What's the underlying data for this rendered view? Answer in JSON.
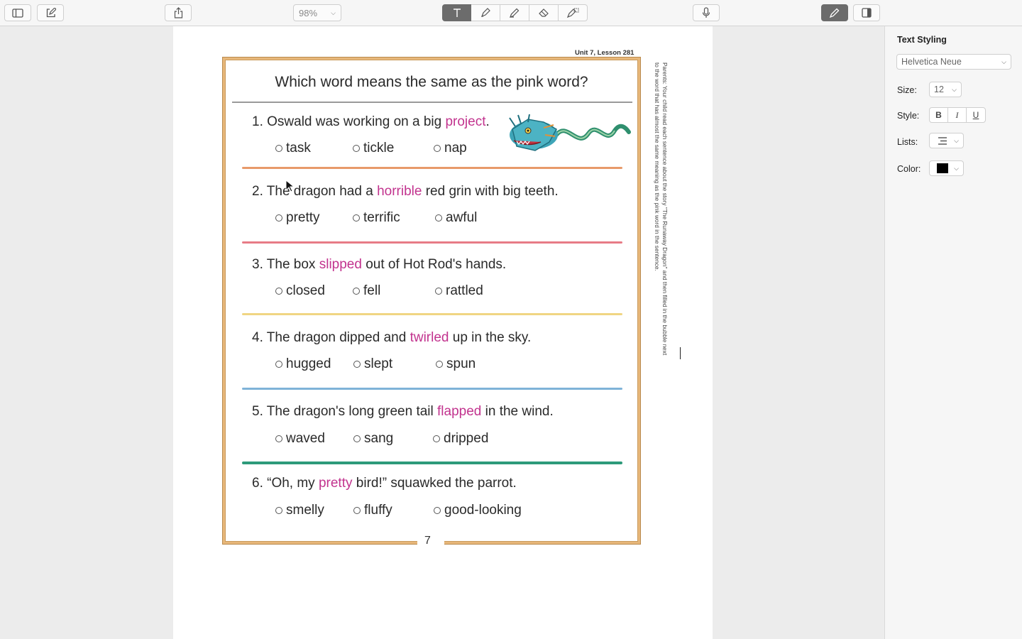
{
  "toolbar": {
    "zoom_value": "98%",
    "icons": [
      "sidebar-toggle-icon",
      "compose-icon",
      "share-icon",
      "text-tool-icon",
      "highlighter-icon",
      "pen-icon",
      "eraser-icon",
      "lasso-icon",
      "microphone-icon",
      "markup-icon",
      "inspector-icon"
    ]
  },
  "document": {
    "unit_label": "Unit 7, Lesson 281",
    "title": "Which word means the same as the pink word?",
    "side_note": "Parents: Your child read each sentence about the story \"The Runaway Dragon\" and then filled in the bubble next to the word that has almost the same meaning as the pink word in the sentence.",
    "page_number": "7",
    "questions": [
      {
        "before": "1. Oswald was working on a big ",
        "pink": "project",
        "after": ".",
        "options": [
          "task",
          "tickle",
          "nap"
        ],
        "rule_color": "#e89a6a"
      },
      {
        "before": "2. The dragon had a ",
        "pink": "horrible",
        "after": " red grin with big teeth.",
        "options": [
          "pretty",
          "terrific",
          "awful"
        ],
        "rule_color": "#e77b86"
      },
      {
        "before": "3. The box ",
        "pink": "slipped",
        "after": " out of Hot Rod's hands.",
        "options": [
          "closed",
          "fell",
          "rattled"
        ],
        "rule_color": "#f0d583"
      },
      {
        "before": "4. The dragon dipped and ",
        "pink": "twirled",
        "after": " up in the sky.",
        "options": [
          "hugged",
          "slept",
          "spun"
        ],
        "rule_color": "#7fb3d8"
      },
      {
        "before": "5. The dragon's long green tail ",
        "pink": "flapped",
        "after": " in the wind.",
        "options": [
          "waved",
          "sang",
          "dripped"
        ],
        "rule_color": "#2d9a7a"
      },
      {
        "before": "6. “Oh, my ",
        "pink": "pretty",
        "after": " bird!” squawked the parrot.",
        "options": [
          "smelly",
          "fluffy",
          "good-looking"
        ],
        "rule_color": null
      }
    ]
  },
  "sidebar": {
    "title": "Text Styling",
    "font": "Helvetica Neue",
    "size_label": "Size:",
    "size_value": "12",
    "style_label": "Style:",
    "style_bold": "B",
    "style_italic": "I",
    "style_underline": "U",
    "lists_label": "Lists:",
    "color_label": "Color:",
    "color_value": "#000000"
  }
}
